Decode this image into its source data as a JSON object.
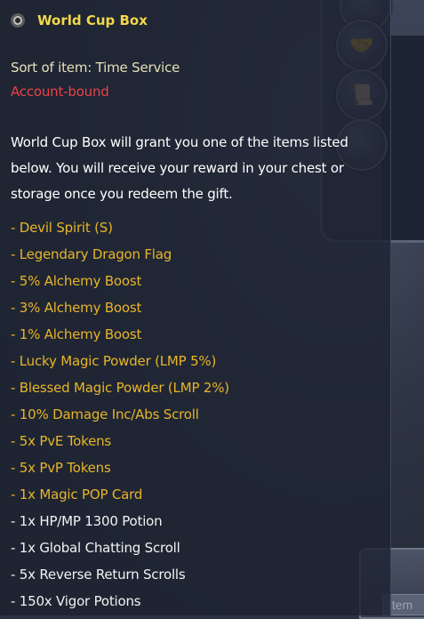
{
  "background": {
    "bottom_label": "Item"
  },
  "tooltip": {
    "title": "World Cup Box",
    "sort_line": "Sort of item: Time Service",
    "binding": "Account-bound",
    "description": "World Cup Box will grant you one of the items listed below. You will receive your reward in your chest or storage once you redeem the gift.",
    "items": [
      {
        "text": "- Devil Spirit (S)",
        "color": "gold"
      },
      {
        "text": "- Legendary Dragon Flag",
        "color": "gold"
      },
      {
        "text": "- 5% Alchemy Boost",
        "color": "gold"
      },
      {
        "text": "- 3% Alchemy Boost",
        "color": "gold"
      },
      {
        "text": "- 1% Alchemy Boost",
        "color": "gold"
      },
      {
        "text": "- Lucky Magic Powder (LMP 5%)",
        "color": "gold"
      },
      {
        "text": "- Blessed Magic Powder (LMP 2%)",
        "color": "gold"
      },
      {
        "text": "- 10% Damage Inc/Abs Scroll",
        "color": "gold"
      },
      {
        "text": "- 5x PvE Tokens",
        "color": "gold"
      },
      {
        "text": "- 5x PvP Tokens",
        "color": "gold"
      },
      {
        "text": "- 1x Magic POP Card",
        "color": "gold"
      },
      {
        "text": "- 1x HP/MP 1300 Potion",
        "color": "white"
      },
      {
        "text": "- 1x Global Chatting Scroll",
        "color": "white"
      },
      {
        "text": "- 5x Reverse Return Scrolls",
        "color": "white"
      },
      {
        "text": "- 150x Vigor Potions",
        "color": "white"
      }
    ]
  },
  "colors": {
    "title": "#f2d84a",
    "binding": "#e8434a",
    "rare_item": "#e8b52a",
    "common_item": "#f2f2f2"
  }
}
